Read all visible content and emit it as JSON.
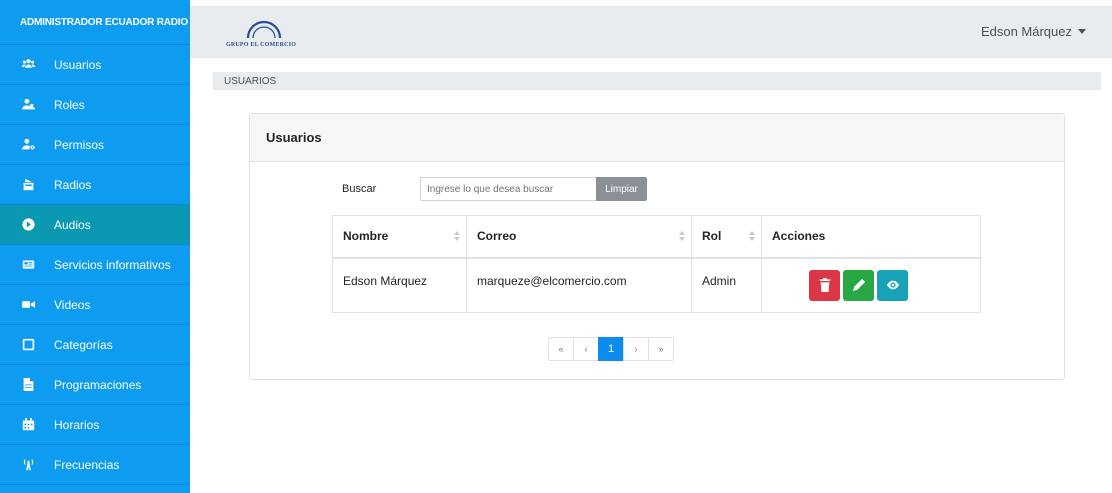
{
  "sidebar": {
    "title": "ADMINISTRADOR ECUADOR RADIO",
    "items": [
      {
        "label": "Usuarios",
        "icon": "users-icon"
      },
      {
        "label": "Roles",
        "icon": "user-group-icon"
      },
      {
        "label": "Permisos",
        "icon": "user-key-icon"
      },
      {
        "label": "Radios",
        "icon": "radio-icon"
      },
      {
        "label": "Audios",
        "icon": "play-circle-icon",
        "active": true
      },
      {
        "label": "Servicios informativos",
        "icon": "newspaper-icon"
      },
      {
        "label": "Videos",
        "icon": "video-icon"
      },
      {
        "label": "Categorías",
        "icon": "clone-icon"
      },
      {
        "label": "Programaciones",
        "icon": "file-icon"
      },
      {
        "label": "Horarios",
        "icon": "calendar-icon"
      },
      {
        "label": "Frecuencias",
        "icon": "broadcast-icon"
      }
    ]
  },
  "header": {
    "logo_text": "GRUPO EL COMERCIO",
    "user_name": "Edson Márquez"
  },
  "breadcrumb": "USUARIOS",
  "card": {
    "title": "Usuarios",
    "search_label": "Buscar",
    "search_placeholder": "Ingrese lo que desea buscar",
    "clear_label": "Limpiar"
  },
  "table": {
    "columns": [
      "Nombre",
      "Correo",
      "Rol",
      "Acciones"
    ],
    "rows": [
      {
        "nombre": "Edson Márquez",
        "correo": "marqueze@elcomercio.com",
        "rol": "Admin"
      }
    ]
  },
  "pagination": {
    "first": "«",
    "prev": "‹",
    "current": "1",
    "next": "›",
    "last": "»"
  },
  "colors": {
    "sidebar": "#0d9cf0",
    "sidebar_active": "#0b98b3",
    "delete": "#dc3545",
    "edit": "#28a745",
    "view": "#17a2b8"
  }
}
